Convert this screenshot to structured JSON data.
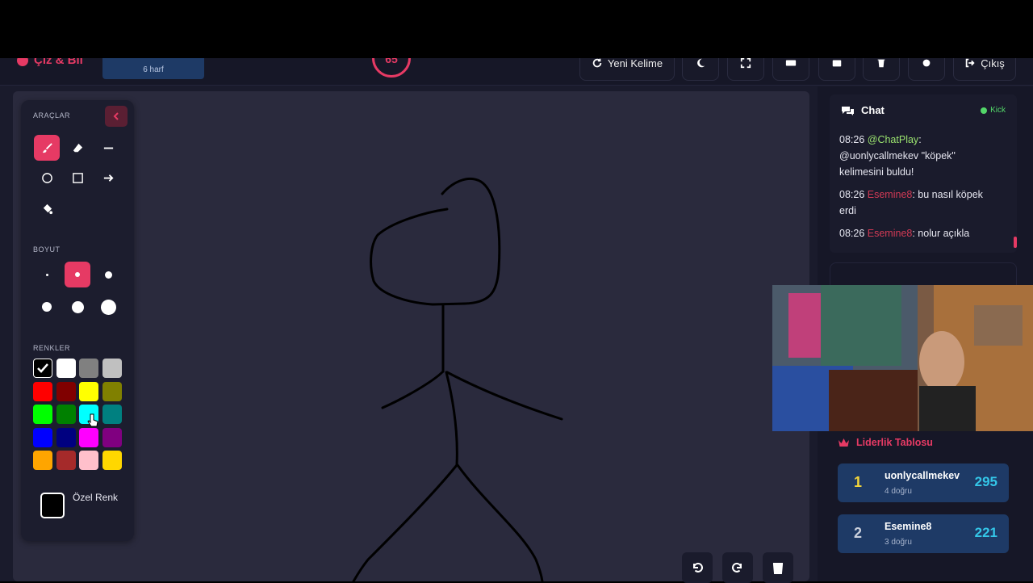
{
  "header": {
    "logo": "Çiz & Bil",
    "word_hint": "6 harf",
    "timer": "65",
    "new_word": "Yeni Kelime",
    "exit": "Çıkış"
  },
  "tools_panel": {
    "tools_title": "ARAÇLAR",
    "size_title": "BOYUT",
    "colors_title": "RENKLER",
    "custom_color": "Özel Renk",
    "colors": [
      "#000000",
      "#ffffff",
      "#808080",
      "#c0c0c0",
      "#ff0000",
      "#800000",
      "#ffff00",
      "#808000",
      "#00ff00",
      "#008000",
      "#00ffff",
      "#008080",
      "#0000ff",
      "#000080",
      "#ff00ff",
      "#800080",
      "#ffa500",
      "#a52a2a",
      "#ffc0cb",
      "#ffd700"
    ]
  },
  "chat": {
    "title": "Chat",
    "platform": "Kick",
    "messages": [
      {
        "time": "08:26",
        "user": "@ChatPlay",
        "text": ": @uonlycallmekev \"köpek\" kelimesini buldu!"
      },
      {
        "time": "08:26",
        "user": "Esemine8",
        "text": ": bu nasıl köpek erdi"
      },
      {
        "time": "08:26",
        "user": "Esemine8",
        "text": ": nolur açıkla"
      }
    ]
  },
  "leaderboard": {
    "title": "Liderlik Tablosu",
    "rows": [
      {
        "rank": "1",
        "name": "uonlycallmekev",
        "sub": "4 doğru",
        "score": "295"
      },
      {
        "rank": "2",
        "name": "Esemine8",
        "sub": "3 doğru",
        "score": "221"
      }
    ]
  },
  "colors": {
    "accent": "#e63a64",
    "panel": "#1c1d2e",
    "canvas": "#2a2a3d",
    "score": "#34c6e8"
  }
}
